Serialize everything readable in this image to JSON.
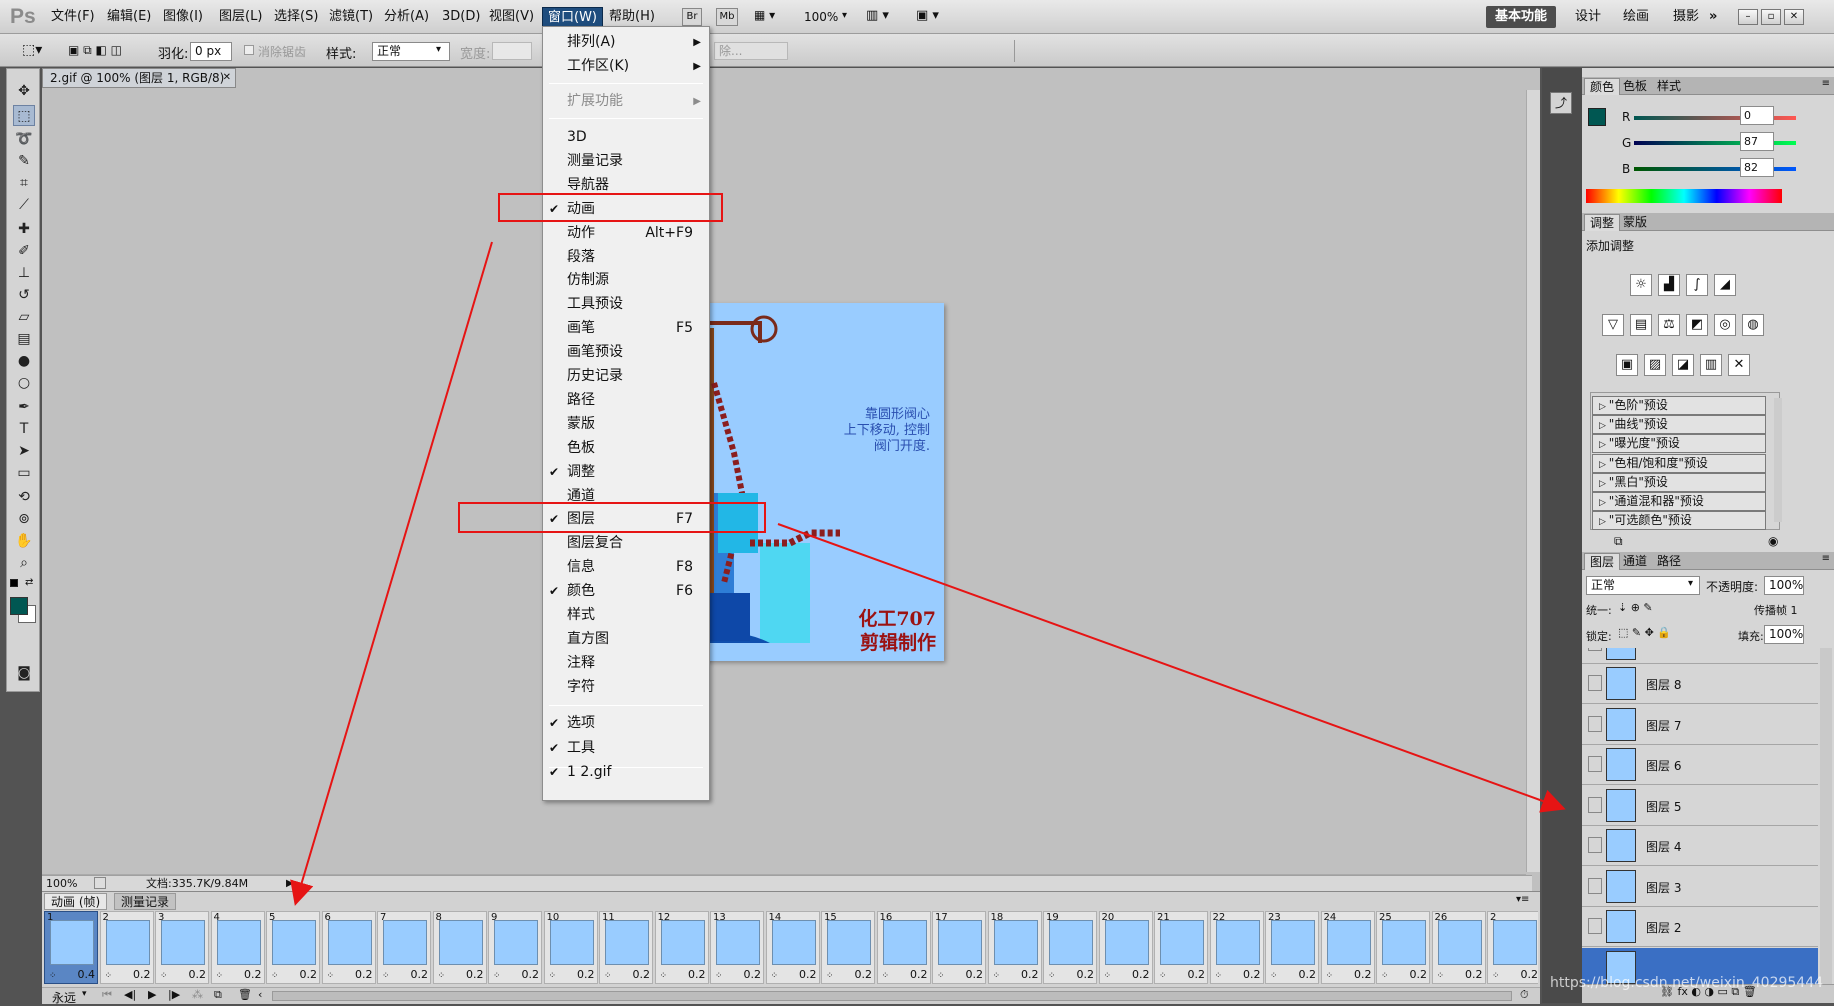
{
  "app": {
    "logo": "Ps"
  },
  "menubar": {
    "items": [
      "文件(F)",
      "编辑(E)",
      "图像(I)",
      "图层(L)",
      "选择(S)",
      "滤镜(T)",
      "分析(A)",
      "3D(D)",
      "视图(V)",
      "窗口(W)",
      "帮助(H)"
    ],
    "bridge": "Br",
    "minibridge": "Mb",
    "zoom": "100%",
    "workspaces": [
      "基本功能",
      "设计",
      "绘画",
      "摄影"
    ],
    "more": "»",
    "active_workspace": "基本功能"
  },
  "options": {
    "feather_label": "羽化:",
    "feather_value": "0 px",
    "antialias": "消除锯齿",
    "style_label": "样式:",
    "style_value": "正常",
    "width_label": "宽度:",
    "obscured_text": "除..."
  },
  "document": {
    "tab": "2.gif @ 100% (图层 1, RGB/8)",
    "caption": [
      "靠圆形阀心",
      "上下移动, 控制",
      "阀门开度."
    ],
    "brand": [
      "化工707",
      "剪辑制作"
    ]
  },
  "status": {
    "zoom": "100%",
    "doc": "文档:335.7K/9.84M"
  },
  "animation": {
    "tabs": [
      "动画 (帧)",
      "测量记录"
    ],
    "loop": "永远",
    "frames": [
      "1",
      "2",
      "3",
      "4",
      "5",
      "6",
      "7",
      "8",
      "9",
      "10",
      "11",
      "12",
      "13",
      "14",
      "15",
      "16",
      "17",
      "18",
      "19",
      "20",
      "21",
      "22",
      "23",
      "24",
      "25",
      "26",
      "2"
    ],
    "first_delay": "0.4",
    "delay": "0.2"
  },
  "color_panel": {
    "tabs": [
      "颜色",
      "色板",
      "样式"
    ],
    "r_label": "R",
    "g_label": "G",
    "b_label": "B",
    "r": "0",
    "g": "87",
    "b": "82",
    "fg": "#005752"
  },
  "adjust_panel": {
    "tabs": [
      "调整",
      "蒙版"
    ],
    "title": "添加调整",
    "presets": [
      "\"色阶\"预设",
      "\"曲线\"预设",
      "\"曝光度\"预设",
      "\"色相/饱和度\"预设",
      "\"黑白\"预设",
      "\"通道混和器\"预设",
      "\"可选颜色\"预设"
    ]
  },
  "layers_panel": {
    "tabs": [
      "图层",
      "通道",
      "路径"
    ],
    "blend": "正常",
    "opacity_label": "不透明度:",
    "opacity": "100%",
    "unify_label": "统一:",
    "propagate": "传播帧 1",
    "lock_label": "锁定:",
    "fill_label": "填充:",
    "fill": "100%",
    "layers": [
      "图层 8",
      "图层 7",
      "图层 6",
      "图层 5",
      "图层 4",
      "图层 3",
      "图层 2"
    ]
  },
  "window_menu": {
    "arrange": "排列(A)",
    "workspace": "工作区(K)",
    "extensions": "扩展功能",
    "items": [
      {
        "label": "3D",
        "check": "",
        "sc": ""
      },
      {
        "label": "测量记录",
        "check": "",
        "sc": ""
      },
      {
        "label": "导航器",
        "check": "",
        "sc": ""
      },
      {
        "label": "动画",
        "check": "✔",
        "sc": ""
      },
      {
        "label": "动作",
        "check": "",
        "sc": "Alt+F9"
      },
      {
        "label": "段落",
        "check": "",
        "sc": ""
      },
      {
        "label": "仿制源",
        "check": "",
        "sc": ""
      },
      {
        "label": "工具预设",
        "check": "",
        "sc": ""
      },
      {
        "label": "画笔",
        "check": "",
        "sc": "F5"
      },
      {
        "label": "画笔预设",
        "check": "",
        "sc": ""
      },
      {
        "label": "历史记录",
        "check": "",
        "sc": ""
      },
      {
        "label": "路径",
        "check": "",
        "sc": ""
      },
      {
        "label": "蒙版",
        "check": "",
        "sc": ""
      },
      {
        "label": "色板",
        "check": "",
        "sc": ""
      },
      {
        "label": "调整",
        "check": "✔",
        "sc": ""
      },
      {
        "label": "通道",
        "check": "",
        "sc": ""
      },
      {
        "label": "图层",
        "check": "✔",
        "sc": "F7"
      },
      {
        "label": "图层复合",
        "check": "",
        "sc": ""
      },
      {
        "label": "信息",
        "check": "",
        "sc": "F8"
      },
      {
        "label": "颜色",
        "check": "✔",
        "sc": "F6"
      },
      {
        "label": "样式",
        "check": "",
        "sc": ""
      },
      {
        "label": "直方图",
        "check": "",
        "sc": ""
      },
      {
        "label": "注释",
        "check": "",
        "sc": ""
      },
      {
        "label": "字符",
        "check": "",
        "sc": ""
      }
    ],
    "bottom": [
      {
        "label": "选项",
        "check": "✔"
      },
      {
        "label": "工具",
        "check": "✔"
      },
      {
        "label": "1 2.gif",
        "check": "✔"
      }
    ]
  },
  "watermark": "https://blog.csdn.net/weixin_40295444"
}
